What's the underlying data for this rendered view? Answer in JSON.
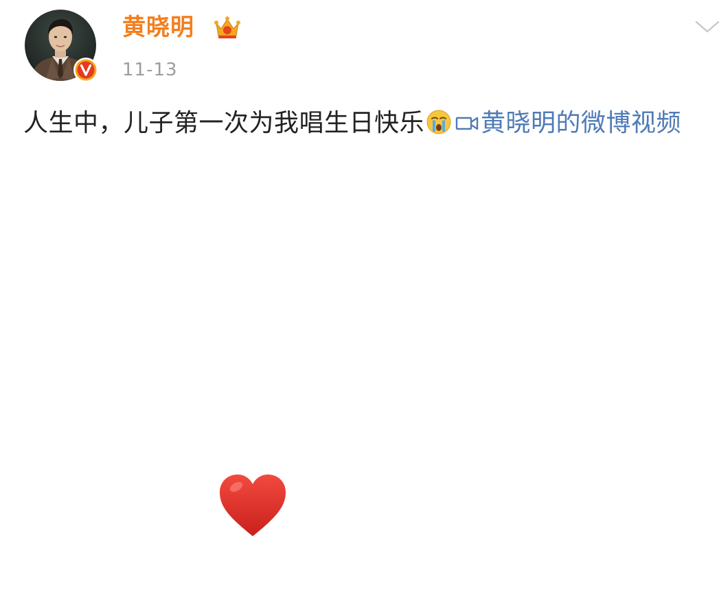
{
  "post": {
    "author": {
      "name": "黄晓明",
      "avatar_icon": "avatar-photo",
      "verified_badge_icon": "verified-v-icon",
      "member_icon": "crown-icon"
    },
    "date": "11-13",
    "text": "人生中，儿子第一次为我唱生日快乐",
    "text_emoji_icon": "crying-face-icon",
    "video_link": {
      "icon": "video-camera-icon",
      "label": "黄晓明的微博视频"
    },
    "menu_icon": "chevron-down-icon"
  },
  "reaction": {
    "icon": "red-heart-icon"
  },
  "colors": {
    "username": "#f37f1e",
    "timestamp": "#9d9d9d",
    "body_text": "#222222",
    "link": "#4f7bb6",
    "heart": "#e8342f"
  }
}
